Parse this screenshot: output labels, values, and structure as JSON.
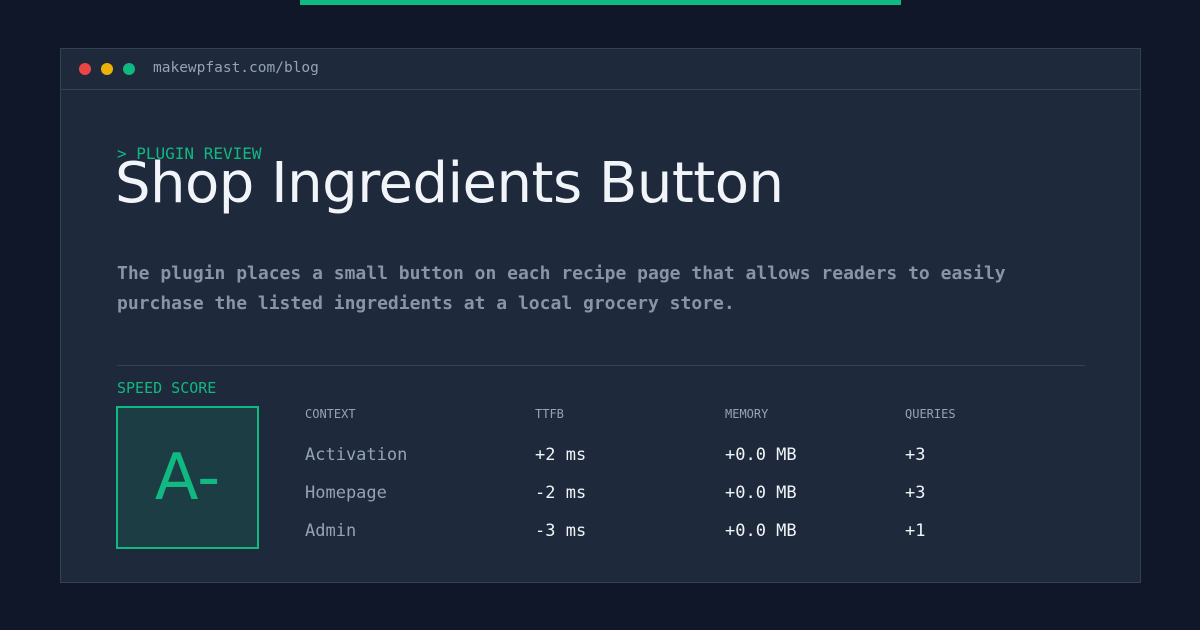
{
  "browser": {
    "url": "makewpfast.com/blog"
  },
  "article": {
    "kicker": "> PLUGIN REVIEW",
    "title": "Shop Ingredients Button",
    "description": "The plugin places a small button on each recipe page that allows readers to easily purchase the listed ingredients at a local grocery store."
  },
  "speed": {
    "label": "SPEED SCORE",
    "grade": "A-"
  },
  "table": {
    "headers": [
      "CONTEXT",
      "TTFB",
      "MEMORY",
      "QUERIES"
    ],
    "rows": [
      [
        "Activation",
        "+2 ms",
        "+0.0 MB",
        "+3"
      ],
      [
        "Homepage",
        "-2 ms",
        "+0.0 MB",
        "+3"
      ],
      [
        "Admin",
        "-3 ms",
        "+0.0 MB",
        "+1"
      ]
    ]
  },
  "colors": {
    "accent": "#10b981",
    "background": "#0f1729",
    "panel": "#1e293b",
    "dot_red": "#ef4444",
    "dot_yellow": "#eab308",
    "dot_green": "#10b981"
  }
}
